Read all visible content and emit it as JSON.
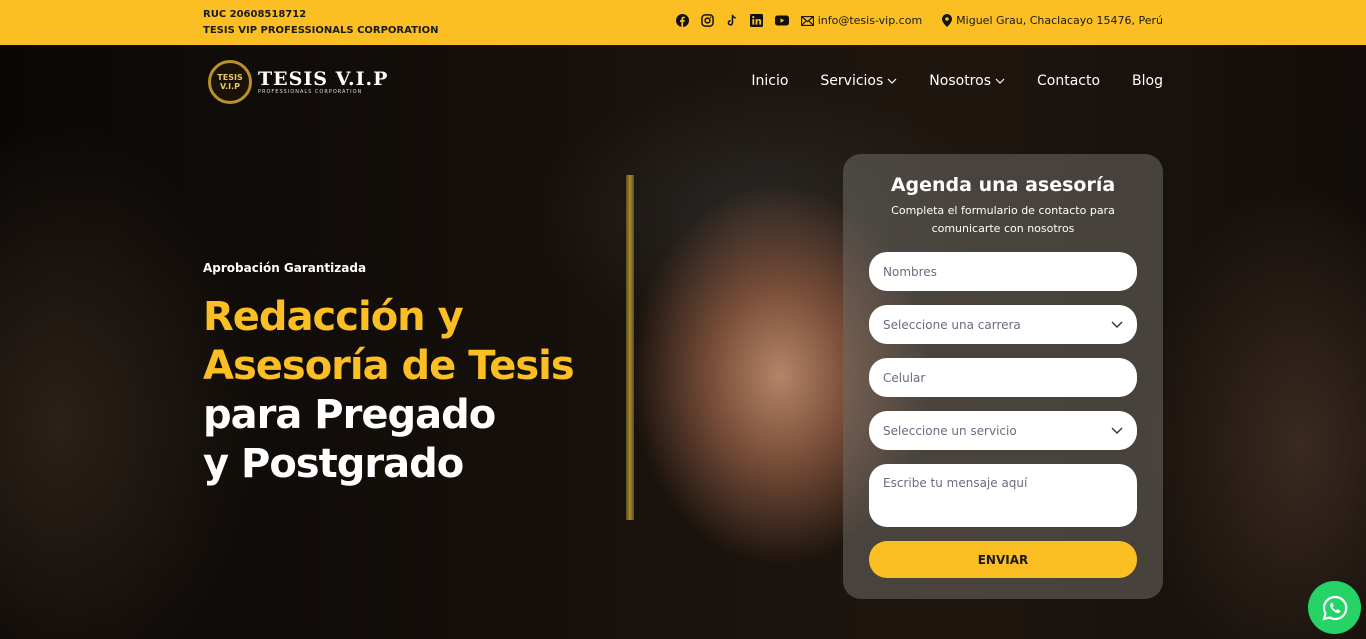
{
  "topbar": {
    "ruc": "RUC 20608518712",
    "company": "TESIS VIP PROFESSIONALS CORPORATION",
    "email": "info@tesis-vip.com",
    "address": "Miguel Grau, Chaclacayo 15476, Perú",
    "social": [
      "facebook-icon",
      "instagram-icon",
      "tiktok-icon",
      "linkedin-icon",
      "youtube-icon"
    ]
  },
  "logo": {
    "seal_top": "TESIS",
    "seal_bottom": "V.I.P",
    "brand": "TESIS V.I.P",
    "sub": "PROFESSIONALS CORPORATION"
  },
  "nav": {
    "items": [
      "Inicio",
      "Servicios",
      "Nosotros",
      "Contacto",
      "Blog"
    ]
  },
  "hero": {
    "kicker": "Aprobación Garantizada",
    "line1": "Redacción y",
    "line2": "Asesoría de Tesis",
    "line3": "para Pregado",
    "line4": "y Postgrado"
  },
  "form": {
    "title": "Agenda una asesoría",
    "subtitle": "Completa el formulario de contacto para comunicarte con nosotros",
    "name_placeholder": "Nombres",
    "career_select": "Seleccione una carrera",
    "phone_placeholder": "Celular",
    "service_select": "Seleccione un servicio",
    "message_placeholder": "Escribe tu mensaje aquí",
    "submit": "ENVIAR"
  },
  "colors": {
    "accent": "#fbbf24",
    "whatsapp": "#25d366"
  }
}
